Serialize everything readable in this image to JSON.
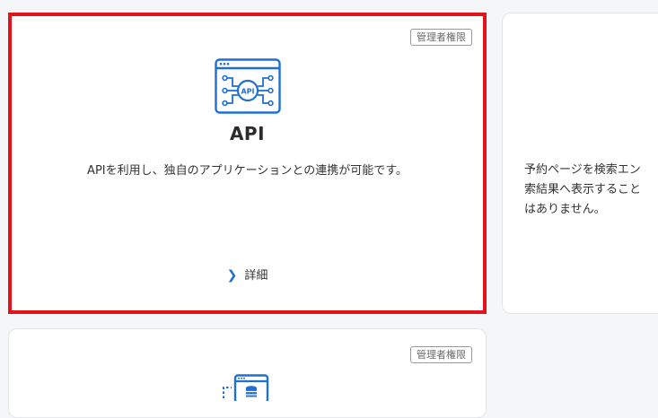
{
  "cards": [
    {
      "badge": "管理者権限",
      "icon": "api-icon",
      "icon_label": "API",
      "title": "API",
      "description": "APIを利用し、独自のアプリケーションとの連携が可能です。",
      "detail_label": "詳細"
    },
    {
      "description": "予約ページを検索エンジン検索結果へ表示することはありません。",
      "description_lines": [
        "予約ページを検索エン",
        "索結果へ表示すること",
        "はありません。"
      ]
    },
    {
      "badge": "管理者権限",
      "icon": "database-window-icon"
    }
  ],
  "colors": {
    "accent": "#1f6fd6",
    "highlight": "#e3131c",
    "card_bg": "#ffffff",
    "page_bg": "#f5f6f7"
  }
}
